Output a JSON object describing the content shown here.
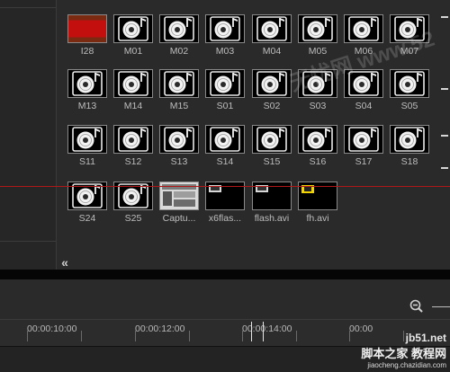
{
  "library": {
    "items": [
      {
        "label": "I28",
        "kind": "video-red"
      },
      {
        "label": "M01",
        "kind": "music"
      },
      {
        "label": "M02",
        "kind": "music"
      },
      {
        "label": "M03",
        "kind": "music"
      },
      {
        "label": "M04",
        "kind": "music"
      },
      {
        "label": "M05",
        "kind": "music"
      },
      {
        "label": "M06",
        "kind": "music"
      },
      {
        "label": "M07",
        "kind": "music"
      },
      {
        "label": "M13",
        "kind": "music"
      },
      {
        "label": "M14",
        "kind": "music"
      },
      {
        "label": "M15",
        "kind": "music"
      },
      {
        "label": "S01",
        "kind": "music"
      },
      {
        "label": "S02",
        "kind": "music"
      },
      {
        "label": "S03",
        "kind": "music"
      },
      {
        "label": "S04",
        "kind": "music"
      },
      {
        "label": "S05",
        "kind": "music"
      },
      {
        "label": "S11",
        "kind": "music"
      },
      {
        "label": "S12",
        "kind": "music"
      },
      {
        "label": "S13",
        "kind": "music"
      },
      {
        "label": "S14",
        "kind": "music"
      },
      {
        "label": "S15",
        "kind": "music"
      },
      {
        "label": "S16",
        "kind": "music"
      },
      {
        "label": "S17",
        "kind": "music"
      },
      {
        "label": "S18",
        "kind": "music"
      },
      {
        "label": "S24",
        "kind": "music"
      },
      {
        "label": "S25",
        "kind": "music"
      },
      {
        "label": "Captu...",
        "kind": "capture"
      },
      {
        "label": "x6flas...",
        "kind": "video-dark"
      },
      {
        "label": "flash.avi",
        "kind": "video-dark"
      },
      {
        "label": "fh.avi",
        "kind": "video-yellow"
      }
    ],
    "collapse_label": "«"
  },
  "timeline": {
    "ticks": [
      "00:00:10:00",
      "00:00:12:00",
      "00:00:14:00",
      "00:00"
    ]
  },
  "watermark": {
    "diagonal": "无忧网 www.52",
    "corner_top": "jb51.net",
    "corner_mid": "脚本之家 教程网",
    "corner_bottom": "jiaocheng.chazidian.com"
  },
  "colors": {
    "red_line": "#b01818",
    "accent_yellow": "#f2d400"
  }
}
